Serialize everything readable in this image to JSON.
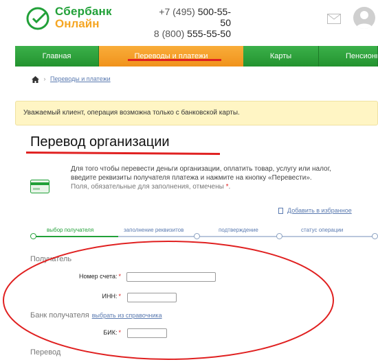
{
  "brand": {
    "line1": "Сбербанк",
    "line2": "Онлайн",
    "green": "#21a038",
    "orange": "#f5a623"
  },
  "phones": {
    "p1_code": "+7 (495)",
    "p1_num": "500-55-50",
    "p2_code": "8 (800)",
    "p2_num": "555-55-50"
  },
  "header": {
    "mail_icon": "envelope-icon",
    "avatar_icon": "user-avatar-icon"
  },
  "nav": {
    "items": [
      {
        "label": "Главная"
      },
      {
        "label": "Переводы и платежи"
      },
      {
        "label": "Карты"
      },
      {
        "label": "Пенсионные"
      }
    ],
    "active_color": "#f5a623",
    "active_item": "Переводы и платежи"
  },
  "breadcrumb": {
    "home_icon": "home-icon",
    "current": "Переводы и платежи"
  },
  "notice": {
    "text": "Уважаемый клиент, операция возможна только с банковской карты."
  },
  "page": {
    "title": "Перевод организации"
  },
  "intro": {
    "line1": "Для того чтобы перевести деньги организации, оплатить товар, услугу или налог,",
    "line2": "введите реквизиты получателя платежа и нажмите на кнопку «Перевести».",
    "line3": "Поля, обязательные для заполнения, отмечены",
    "required_mark": "*",
    "end": "."
  },
  "favorites": {
    "label": "Добавить в избранное",
    "icon": "bookmark-icon"
  },
  "steps": [
    {
      "label": "выбор получателя",
      "active": true
    },
    {
      "label": "заполнение реквизитов",
      "active": false
    },
    {
      "label": "подтверждение",
      "active": false
    },
    {
      "label": "статус операции",
      "active": false
    }
  ],
  "form": {
    "recipient_section": "Получатель",
    "account_label": "Номер счета:",
    "inn_label": "ИНН:",
    "bank_section": "Банк получателя",
    "bank_link": "выбрать из справочника",
    "bik_label": "БИК:",
    "transfer_section": "Перевод",
    "required_mark": "*",
    "account_value": "",
    "inn_value": "",
    "bik_value": ""
  },
  "annotation_color": "#e02020"
}
